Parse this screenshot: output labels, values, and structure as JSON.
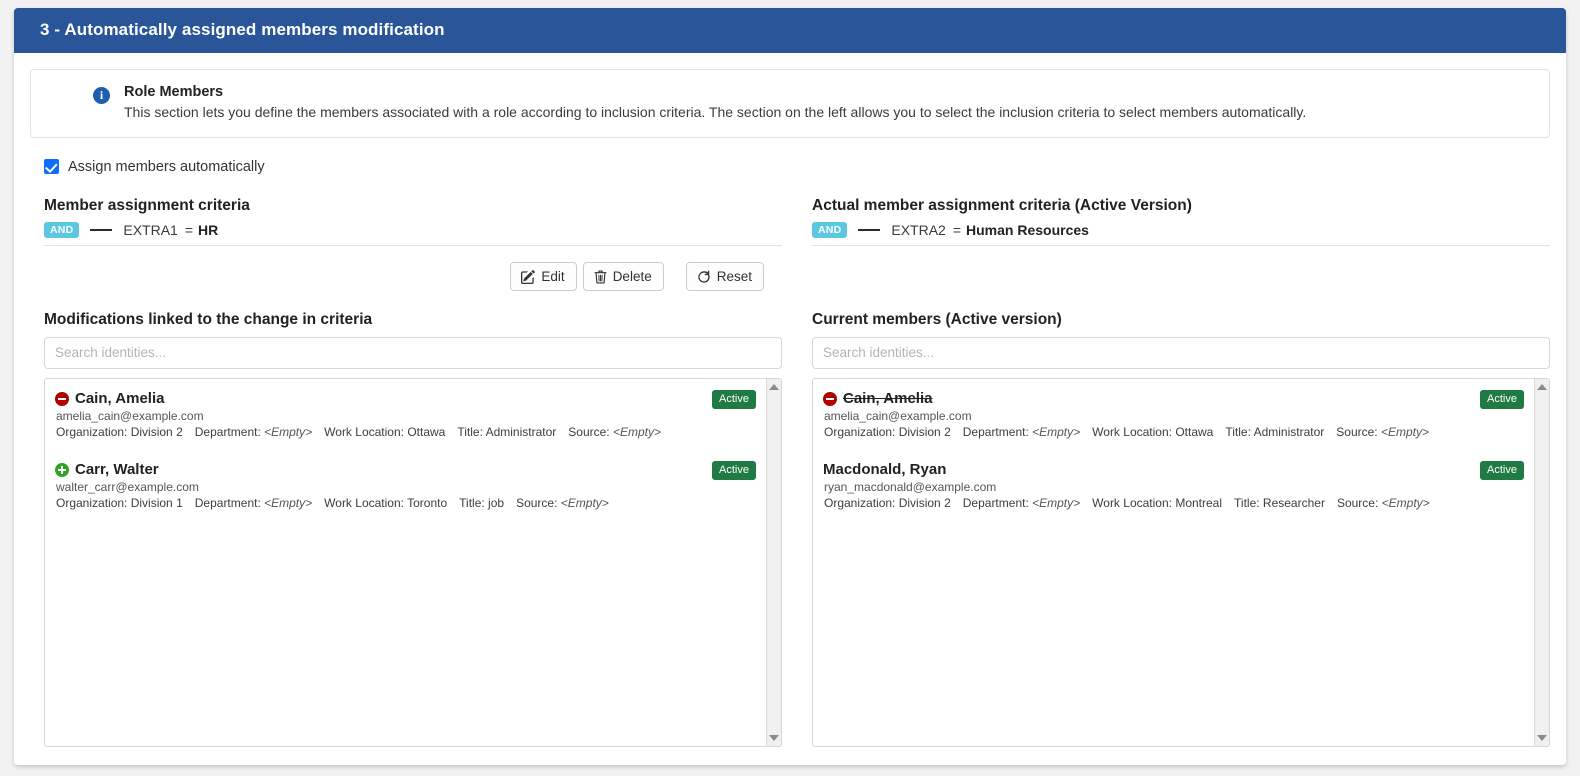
{
  "header": {
    "title": "3 - Automatically assigned members modification"
  },
  "alert": {
    "icon": "info-icon",
    "title": "Role Members",
    "description": "This section lets you define the members associated with a role according to inclusion criteria. The section on the left allows you to select the inclusion criteria to select members automatically."
  },
  "assign_checkbox": {
    "label": "Assign members automatically",
    "checked": true
  },
  "criteria_left": {
    "title": "Member assignment criteria",
    "operator": "AND",
    "attribute": "EXTRA1",
    "comparator": "=",
    "value": "HR"
  },
  "criteria_right": {
    "title": "Actual member assignment criteria (Active Version)",
    "operator": "AND",
    "attribute": "EXTRA2",
    "comparator": "=",
    "value": "Human Resources"
  },
  "buttons": {
    "edit": "Edit",
    "delete": "Delete",
    "reset": "Reset"
  },
  "left_list": {
    "title": "Modifications linked to the change in criteria",
    "search_placeholder": "Search identities...",
    "search_value": "",
    "members": [
      {
        "marker": "remove",
        "name": "Cain, Amelia",
        "struck": false,
        "email": "amelia_cain@example.com",
        "organization_label": "Organization:",
        "organization": "Division 2",
        "department_label": "Department:",
        "department": "<Empty>",
        "work_location_label": "Work Location:",
        "work_location": "Ottawa",
        "title_label": "Title:",
        "title": "Administrator",
        "source_label": "Source:",
        "source": "<Empty>",
        "status": "Active"
      },
      {
        "marker": "add",
        "name": "Carr, Walter",
        "struck": false,
        "email": "walter_carr@example.com",
        "organization_label": "Organization:",
        "organization": "Division 1",
        "department_label": "Department:",
        "department": "<Empty>",
        "work_location_label": "Work Location:",
        "work_location": "Toronto",
        "title_label": "Title:",
        "title": "job",
        "source_label": "Source:",
        "source": "<Empty>",
        "status": "Active"
      }
    ]
  },
  "right_list": {
    "title": "Current members (Active version)",
    "search_placeholder": "Search identities...",
    "search_value": "",
    "members": [
      {
        "marker": "remove",
        "name": "Cain, Amelia",
        "struck": true,
        "email": "amelia_cain@example.com",
        "organization_label": "Organization:",
        "organization": "Division 2",
        "department_label": "Department:",
        "department": "<Empty>",
        "work_location_label": "Work Location:",
        "work_location": "Ottawa",
        "title_label": "Title:",
        "title": "Administrator",
        "source_label": "Source:",
        "source": "<Empty>",
        "status": "Active"
      },
      {
        "marker": "none",
        "name": "Macdonald, Ryan",
        "struck": false,
        "email": "ryan_macdonald@example.com",
        "organization_label": "Organization:",
        "organization": "Division 2",
        "department_label": "Department:",
        "department": "<Empty>",
        "work_location_label": "Work Location:",
        "work_location": "Montreal",
        "title_label": "Title:",
        "title": "Researcher",
        "source_label": "Source:",
        "source": "<Empty>",
        "status": "Active"
      }
    ]
  },
  "colors": {
    "header_blue": "#2a5699",
    "and_badge": "#5bc8e0",
    "active_badge": "#1f7a43",
    "remove_marker": "#b00000",
    "add_marker": "#2ea528",
    "checkbox": "#0d6efd"
  }
}
